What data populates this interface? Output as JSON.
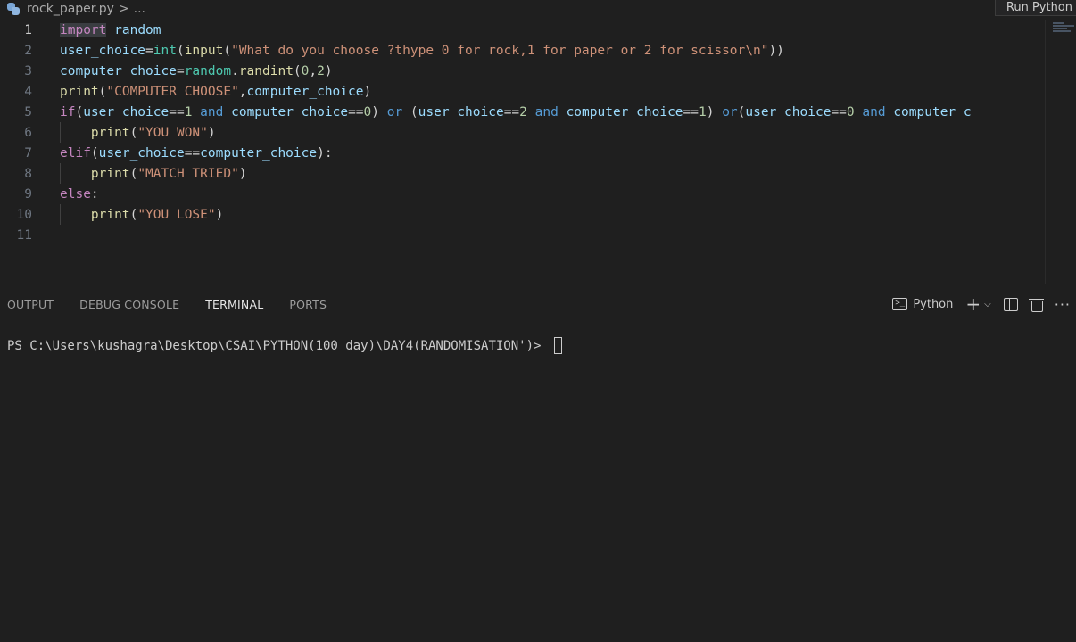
{
  "breadcrumb": {
    "file": "rock_paper.py",
    "separator": ">",
    "more": "..."
  },
  "run_button": {
    "label": "Run Python"
  },
  "editor": {
    "line_numbers": [
      "1",
      "2",
      "3",
      "4",
      "5",
      "6",
      "7",
      "8",
      "9",
      "10",
      "11"
    ],
    "lines": [
      [
        {
          "t": "import",
          "c": "k hl"
        },
        {
          "t": " ",
          "c": "p"
        },
        {
          "t": "random",
          "c": "n"
        }
      ],
      [
        {
          "t": "user_choice",
          "c": "n"
        },
        {
          "t": "=",
          "c": "p"
        },
        {
          "t": "int",
          "c": "b"
        },
        {
          "t": "(",
          "c": "p"
        },
        {
          "t": "input",
          "c": "f"
        },
        {
          "t": "(",
          "c": "p"
        },
        {
          "t": "\"What do you choose ?thype 0 for rock,1 for paper or 2 for scissor\\n\"",
          "c": "s"
        },
        {
          "t": "))",
          "c": "p"
        }
      ],
      [
        {
          "t": "computer_choice",
          "c": "n"
        },
        {
          "t": "=",
          "c": "p"
        },
        {
          "t": "random",
          "c": "b"
        },
        {
          "t": ".",
          "c": "p"
        },
        {
          "t": "randint",
          "c": "f"
        },
        {
          "t": "(",
          "c": "p"
        },
        {
          "t": "0",
          "c": "num"
        },
        {
          "t": ",",
          "c": "p"
        },
        {
          "t": "2",
          "c": "num"
        },
        {
          "t": ")",
          "c": "p"
        }
      ],
      [
        {
          "t": "print",
          "c": "f"
        },
        {
          "t": "(",
          "c": "p"
        },
        {
          "t": "\"COMPUTER CHOOSE\"",
          "c": "s"
        },
        {
          "t": ",",
          "c": "p"
        },
        {
          "t": "computer_choice",
          "c": "n"
        },
        {
          "t": ")",
          "c": "p"
        }
      ],
      [
        {
          "t": "if",
          "c": "k"
        },
        {
          "t": "(",
          "c": "p"
        },
        {
          "t": "user_choice",
          "c": "n"
        },
        {
          "t": "==",
          "c": "p"
        },
        {
          "t": "1",
          "c": "num"
        },
        {
          "t": " ",
          "c": "p"
        },
        {
          "t": "and",
          "c": "op"
        },
        {
          "t": " ",
          "c": "p"
        },
        {
          "t": "computer_choice",
          "c": "n"
        },
        {
          "t": "==",
          "c": "p"
        },
        {
          "t": "0",
          "c": "num"
        },
        {
          "t": ") ",
          "c": "p"
        },
        {
          "t": "or",
          "c": "op"
        },
        {
          "t": " (",
          "c": "p"
        },
        {
          "t": "user_choice",
          "c": "n"
        },
        {
          "t": "==",
          "c": "p"
        },
        {
          "t": "2",
          "c": "num"
        },
        {
          "t": " ",
          "c": "p"
        },
        {
          "t": "and",
          "c": "op"
        },
        {
          "t": " ",
          "c": "p"
        },
        {
          "t": "computer_choice",
          "c": "n"
        },
        {
          "t": "==",
          "c": "p"
        },
        {
          "t": "1",
          "c": "num"
        },
        {
          "t": ") ",
          "c": "p"
        },
        {
          "t": "or",
          "c": "op"
        },
        {
          "t": "(",
          "c": "p"
        },
        {
          "t": "user_choice",
          "c": "n"
        },
        {
          "t": "==",
          "c": "p"
        },
        {
          "t": "0",
          "c": "num"
        },
        {
          "t": " ",
          "c": "p"
        },
        {
          "t": "and",
          "c": "op"
        },
        {
          "t": " ",
          "c": "p"
        },
        {
          "t": "computer_c",
          "c": "n"
        }
      ],
      [
        {
          "t": "    ",
          "c": "p"
        },
        {
          "t": "print",
          "c": "f"
        },
        {
          "t": "(",
          "c": "p"
        },
        {
          "t": "\"YOU WON\"",
          "c": "s"
        },
        {
          "t": ")",
          "c": "p"
        }
      ],
      [
        {
          "t": "elif",
          "c": "k"
        },
        {
          "t": "(",
          "c": "p"
        },
        {
          "t": "user_choice",
          "c": "n"
        },
        {
          "t": "==",
          "c": "p"
        },
        {
          "t": "computer_choice",
          "c": "n"
        },
        {
          "t": "):",
          "c": "p"
        }
      ],
      [
        {
          "t": "    ",
          "c": "p"
        },
        {
          "t": "print",
          "c": "f"
        },
        {
          "t": "(",
          "c": "p"
        },
        {
          "t": "\"MATCH TRIED\"",
          "c": "s"
        },
        {
          "t": ")",
          "c": "p"
        }
      ],
      [
        {
          "t": "else",
          "c": "k"
        },
        {
          "t": ":",
          "c": "p"
        }
      ],
      [
        {
          "t": "    ",
          "c": "p"
        },
        {
          "t": "print",
          "c": "f"
        },
        {
          "t": "(",
          "c": "p"
        },
        {
          "t": "\"YOU LOSE\"",
          "c": "s"
        },
        {
          "t": ")",
          "c": "p"
        }
      ],
      []
    ]
  },
  "panel": {
    "tabs": [
      {
        "label": "OUTPUT",
        "active": false
      },
      {
        "label": "DEBUG CONSOLE",
        "active": false
      },
      {
        "label": "TERMINAL",
        "active": true
      },
      {
        "label": "PORTS",
        "active": false
      }
    ],
    "terminal_profile": "Python",
    "terminal_prompt": "PS C:\\Users\\kushagra\\Desktop\\CSAI\\PYTHON(100 day)\\DAY4(RANDOMISATION')> "
  }
}
